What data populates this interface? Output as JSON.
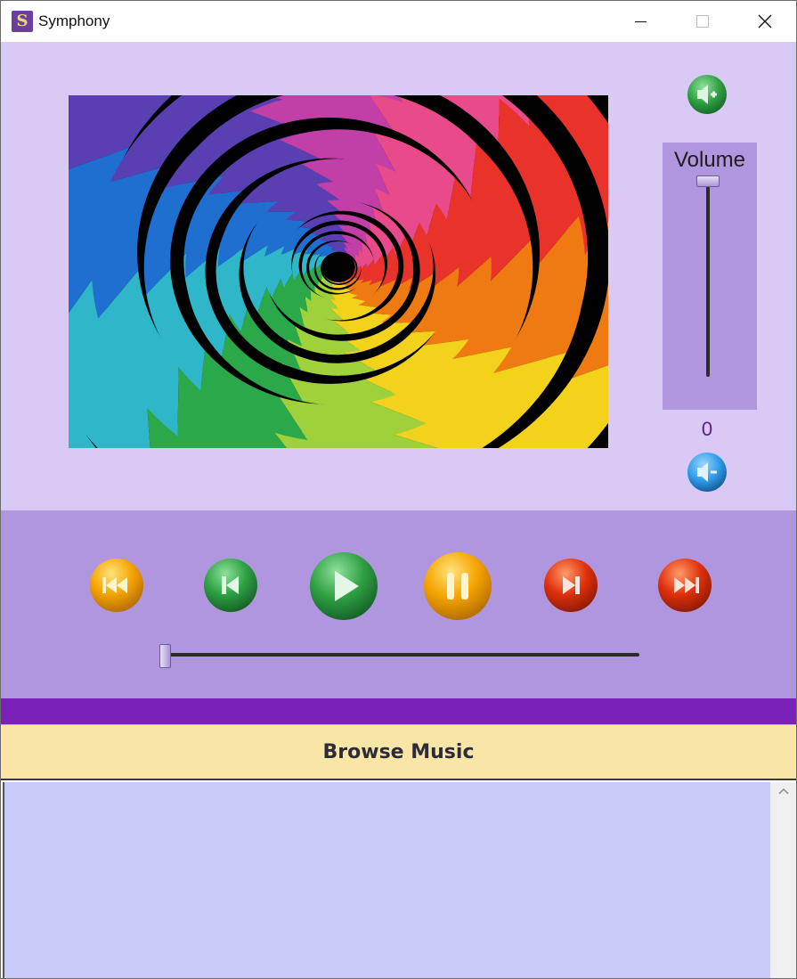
{
  "window": {
    "title": "Symphony",
    "icon_letter": "S"
  },
  "volume": {
    "label": "Volume",
    "value": "0",
    "level": 1.0
  },
  "controls": {
    "buttons": [
      {
        "name": "first-track",
        "color": "#f5a300"
      },
      {
        "name": "previous",
        "color": "#2ea043"
      },
      {
        "name": "play",
        "color": "#2ea043"
      },
      {
        "name": "pause",
        "color": "#f5a300"
      },
      {
        "name": "next",
        "color": "#e0300c"
      },
      {
        "name": "last-track",
        "color": "#e0300c"
      }
    ],
    "seek_progress": 0.0
  },
  "browse": {
    "label": "Browse Music"
  },
  "colors": {
    "top_panel": "#d8c9f5",
    "controls_panel": "#b096de",
    "accent_bar": "#7a22b8",
    "browse_button": "#f9e6a6",
    "playlist": "#c9cbf9"
  },
  "icons": [
    "app-icon",
    "volume-up-icon",
    "volume-down-icon",
    "skip-back-icon",
    "previous-icon",
    "play-icon",
    "pause-icon",
    "next-icon",
    "skip-forward-icon",
    "close-icon",
    "minimize-icon",
    "maximize-icon",
    "scroll-up-icon"
  ]
}
